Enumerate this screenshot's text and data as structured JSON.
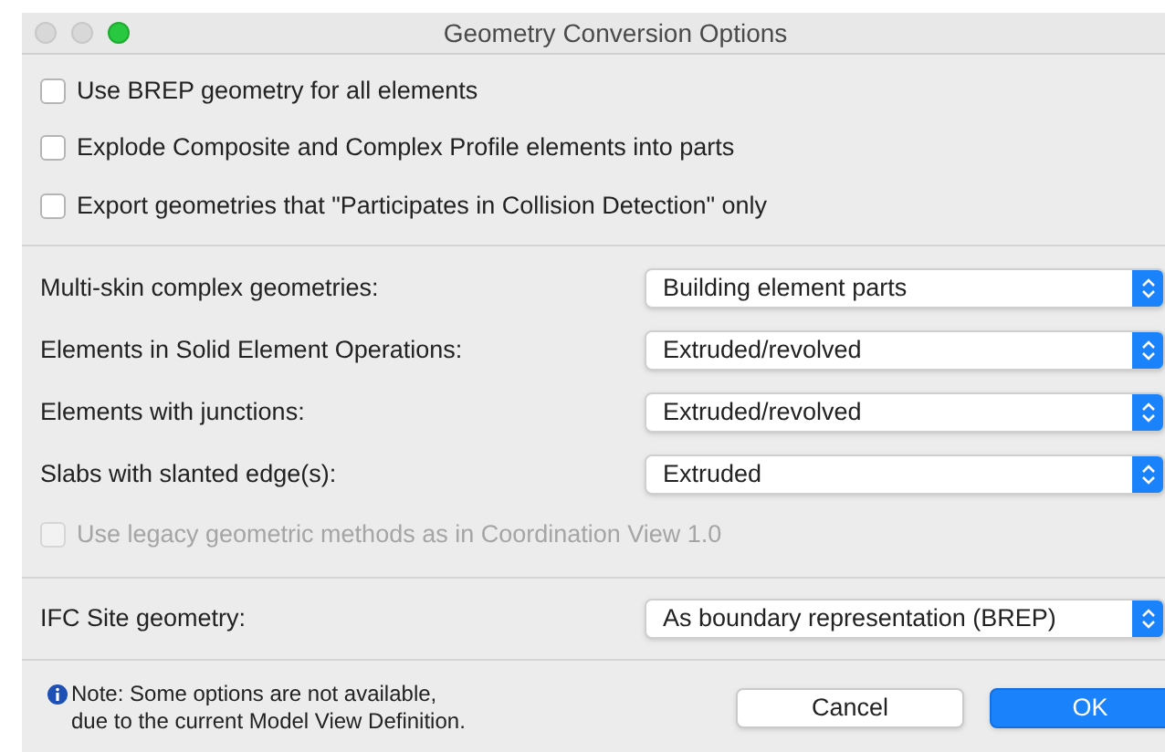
{
  "window": {
    "title": "Geometry Conversion Options"
  },
  "options": [
    {
      "label": "Use BREP geometry for all elements",
      "checked": false,
      "disabled": false
    },
    {
      "label": "Explode Composite and Complex Profile elements into parts",
      "checked": false,
      "disabled": false
    },
    {
      "label": "Export geometries that \"Participates in Collision Detection\" only",
      "checked": false,
      "disabled": false
    }
  ],
  "settings": [
    {
      "label": "Multi-skin complex geometries:",
      "value": "Building element parts"
    },
    {
      "label": "Elements in Solid Element Operations:",
      "value": "Extruded/revolved"
    },
    {
      "label": "Elements with junctions:",
      "value": "Extruded/revolved"
    },
    {
      "label": "Slabs with slanted edge(s):",
      "value": "Extruded"
    }
  ],
  "legacy_option": {
    "label": "Use legacy geometric methods as in Coordination View 1.0",
    "checked": false,
    "disabled": true
  },
  "site": {
    "label": "IFC Site geometry:",
    "value": "As boundary representation (BREP)"
  },
  "note": [
    "Note: Some options are not available,",
    "due to the current Model View Definition."
  ],
  "buttons": [
    {
      "label": "Cancel",
      "kind": "secondary"
    },
    {
      "label": "OK",
      "kind": "primary"
    }
  ]
}
